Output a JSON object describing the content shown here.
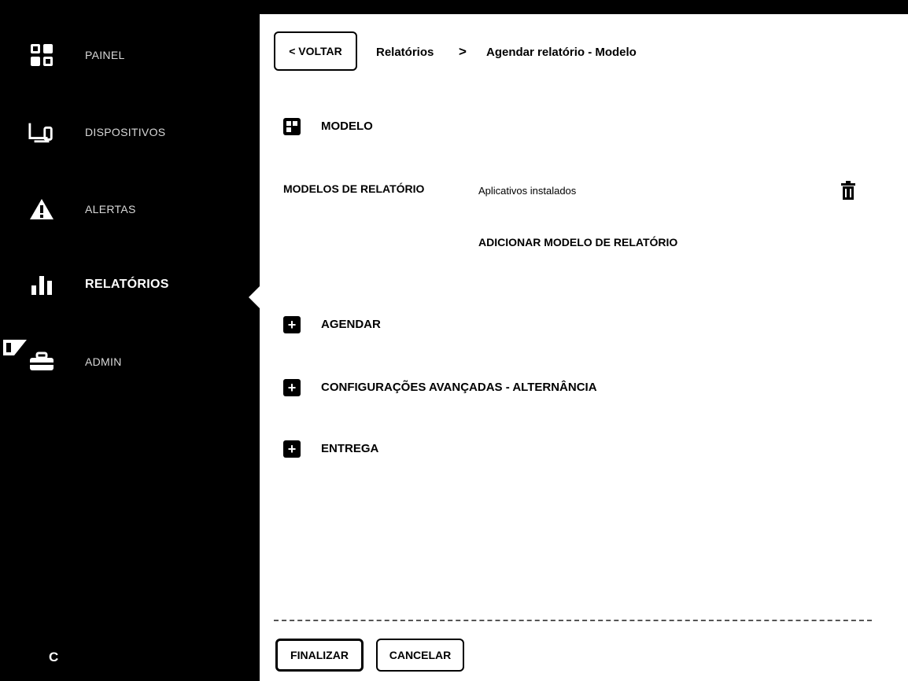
{
  "sidebar": {
    "items": [
      {
        "label": "PAINEL",
        "icon": "dashboard-icon"
      },
      {
        "label": "DISPOSITIVOS",
        "icon": "devices-icon"
      },
      {
        "label": "ALERTAS",
        "icon": "alert-icon"
      },
      {
        "label": "RELATÓRIOS",
        "icon": "bar-chart-icon"
      },
      {
        "label": "ADMIN",
        "icon": "admin-icon"
      }
    ],
    "bottom_label": "C"
  },
  "header": {
    "back_label": "< VOLTAR",
    "breadcrumb": [
      "Relatórios",
      "Agendar relatório - Modelo"
    ],
    "separator": ">"
  },
  "sections": {
    "modelo": "MODELO",
    "agendar": "AGENDAR",
    "config": "CONFIGURAÇÕES AVANÇADAS - ALTERNÂNCIA",
    "entrega": "ENTREGA"
  },
  "form": {
    "label": "MODELOS DE RELATÓRIO",
    "value": "Aplicativos instalados",
    "add_link": "ADICIONAR MODELO DE RELATÓRIO"
  },
  "footer": {
    "finish_label": "FINALIZAR",
    "cancel_label": "CANCELAR"
  }
}
